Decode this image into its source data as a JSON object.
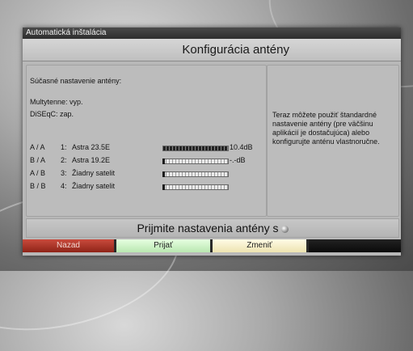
{
  "window": {
    "title": "Automatická inštalácia",
    "heading": "Konfigurácia antény"
  },
  "settings": {
    "header": "Súčasné nastavenie antény:",
    "multytenne": "Multytenne: vyp.",
    "diseqc": "DiSEqC: zap."
  },
  "satellites": [
    {
      "port": "A / A",
      "index": "1:",
      "name": "Astra 23.5E",
      "signal": "10.4dB",
      "level": 1.0
    },
    {
      "port": "B / A",
      "index": "2:",
      "name": "Astra 19.2E",
      "signal": "-.-dB",
      "level": 0.0
    },
    {
      "port": "A / B",
      "index": "3:",
      "name": "Žiadny satelit",
      "signal": "",
      "level": 0.0
    },
    {
      "port": "B / B",
      "index": "4:",
      "name": "Žiadny satelit",
      "signal": "",
      "level": 0.0
    }
  ],
  "info_text": "Teraz môžete použiť štandardné nastavenie antény (pre väčšinu aplikácií je dostačujúca) alebo konfigurujte anténu vlastnoručne.",
  "prompt": {
    "text": "Prijmite nastavenia antény s",
    "icon": "ok-button-icon"
  },
  "buttons": {
    "red": {
      "label": "Nazad",
      "color": "#b33a2c"
    },
    "green": {
      "label": "Prijať",
      "color": "#d8f7cf"
    },
    "yellow": {
      "label": "Zmeniť",
      "color": "#f8f1c8"
    },
    "blue": {
      "label": "",
      "color": "#111111"
    }
  }
}
